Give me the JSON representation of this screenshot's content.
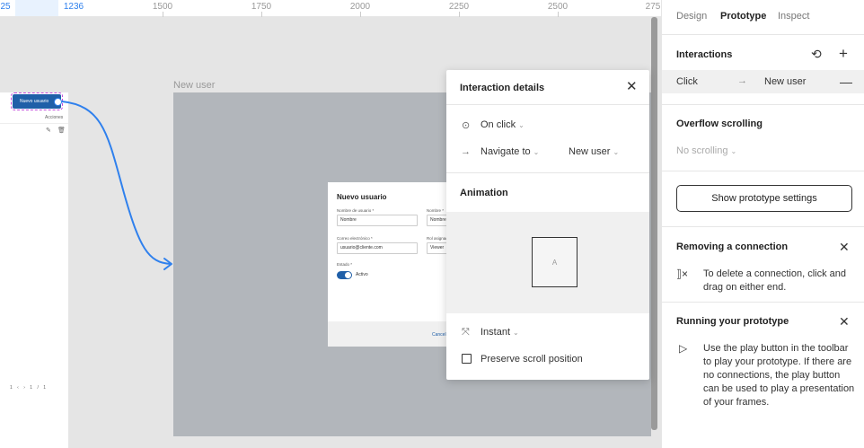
{
  "ruler": {
    "ticks": [
      "25",
      "1236",
      "1500",
      "1750",
      "2000",
      "2250",
      "2500",
      "275"
    ]
  },
  "canvas": {
    "left_frame": {
      "button_label": "Nuevo usuario",
      "acciones": "Acciones",
      "pager": "1 ‹ › 1 / 1"
    },
    "frame_label": "New user",
    "modal": {
      "title": "Nuevo usuario",
      "username_label": "Nombre de usuario *",
      "username_value": "Nombre",
      "name_label": "Nombre *",
      "name_value": "Nombre",
      "email_label": "Correo electrónico *",
      "email_value": "usuario@cliente.com",
      "role_label": "Rol asignado",
      "role_value": "Viewer",
      "status_label": "Estado *",
      "status_value": "Activo",
      "cancel_label": "Cancel"
    }
  },
  "popover": {
    "title": "Interaction details",
    "trigger": "On click",
    "action": "Navigate to",
    "destination": "New user",
    "animation_title": "Animation",
    "preview_label": "A",
    "transition": "Instant",
    "preserve_scroll": "Preserve scroll position"
  },
  "panel": {
    "tabs": [
      {
        "label": "Design"
      },
      {
        "label": "Prototype"
      },
      {
        "label": "Inspect"
      }
    ],
    "interactions_title": "Interactions",
    "interaction_trigger": "Click",
    "interaction_destination": "New user",
    "overflow_title": "Overflow scrolling",
    "overflow_value": "No scrolling",
    "settings_button": "Show prototype settings",
    "removing_title": "Removing a connection",
    "removing_text": "To delete a connection, click and drag on either end.",
    "running_title": "Running your prototype",
    "running_text": "Use the play button in the toolbar to play your prototype. If there are no connections, the play button can be used to play a presentation of your frames."
  },
  "colors": {
    "accent": "#2f80ed",
    "selection": "#c34bdc",
    "button_blue": "#1f5fa8"
  }
}
